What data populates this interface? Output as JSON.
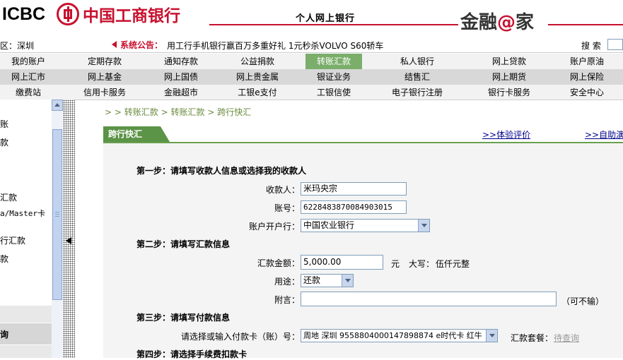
{
  "header": {
    "logo_text": "ICBC",
    "bank_name": "中国工商银行",
    "tagline": "个人网上银行",
    "slogan_left": "金融",
    "slogan_at": "@",
    "slogan_right": "家"
  },
  "notice": {
    "region_label": "区：",
    "region_value": "深圳",
    "label": "系统公告：",
    "text": "用工行手机银行赢百万多重好礼 1元秒杀VOLVO S60轿车",
    "search_label": "搜 索"
  },
  "nav": {
    "row1": [
      "我的账户",
      "定期存款",
      "通知存款",
      "公益捐款",
      "转账汇款",
      "私人银行",
      "网上贷款",
      "账户原油"
    ],
    "row2": [
      "网上汇市",
      "网上基金",
      "网上国债",
      "网上贵金属",
      "银证业务",
      "结售汇",
      "网上期货",
      "网上保险"
    ],
    "row3": [
      "缴费站",
      "信用卡服务",
      "金融超市",
      "工银e支付",
      "工银信使",
      "电子银行注册",
      "银行卡服务",
      "安全中心"
    ],
    "active": "转账汇款"
  },
  "sidebar": {
    "items": [
      "账",
      "款",
      "汇款",
      "a/Master卡",
      "行汇款",
      "款"
    ],
    "bottom_item": "询"
  },
  "breadcrumb": {
    "sep": "> >",
    "item1": "转账汇款",
    "sep2": ">",
    "item2": "转账汇款",
    "sep3": ">",
    "item3": "跨行快汇"
  },
  "tabs": {
    "active": "跨行快汇",
    "link1_prefix": ">>",
    "link1": "体验评价",
    "link2_prefix": ">>",
    "link2": "自助演示"
  },
  "form": {
    "step1": "第一步：请填写收款人信息或选择我的收款人",
    "payee_label": "收款人：",
    "payee_value": "米玛央宗",
    "account_label": "账号：",
    "account_value": "6228483870084903015",
    "bank_label": "账户开户行：",
    "bank_value": "中国农业银行",
    "step2": "第二步：请填写汇款信息",
    "amount_label": "汇款金额：",
    "amount_value": "5,000.00",
    "unit": "元",
    "capital_label": "大写：",
    "capital_value": "伍仟元整",
    "purpose_label": "用途：",
    "purpose_value": "还款",
    "note_label": "附言：",
    "note_value": "",
    "note_hint": "（可不输）",
    "step3": "第三步：请填写付款信息",
    "card_label": "请选择或输入付款卡（账）号：",
    "card_value": "周地 深圳 9558804000147898874 e时代卡 红牛",
    "package_label": "汇款套餐：",
    "package_link": "待查询",
    "step4": "第四步：请选择手续费扣款卡"
  },
  "colors": {
    "brand_red": "#c8102e",
    "nav_active": "#7aae6a",
    "tab_green": "#5b9347",
    "link_blue": "#00008b"
  }
}
